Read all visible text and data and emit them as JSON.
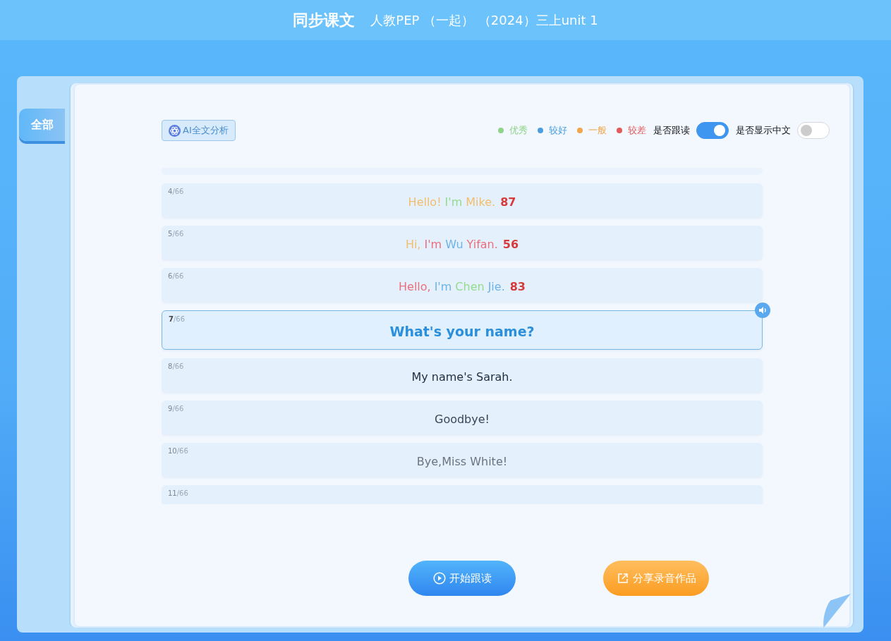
{
  "header": {
    "title": "同步课文",
    "subtitle": "人教PEP （一起） （2024）三上unit 1"
  },
  "sidebar": {
    "tabs": [
      {
        "label": "全部",
        "selected": true
      }
    ]
  },
  "toolbar": {
    "ai_button": "AI全文分析",
    "legend": [
      {
        "label": "优秀",
        "color": "#8fd48a"
      },
      {
        "label": "较好",
        "color": "#4a9ee0"
      },
      {
        "label": "一般",
        "color": "#f0a64a"
      },
      {
        "label": "较差",
        "color": "#e25a5a"
      }
    ],
    "toggles": [
      {
        "label": "是否跟读",
        "on": true
      },
      {
        "label": "是否显示中文",
        "on": false
      }
    ]
  },
  "sentences": [
    {
      "index": "4",
      "total": "/66",
      "selected": false,
      "score": "87",
      "words": [
        {
          "text": "Hello!",
          "color": "#f2bd6e"
        },
        {
          "text": "I'm",
          "color": "#93db8e"
        },
        {
          "text": "Mike.",
          "color": "#f2bd6e"
        }
      ]
    },
    {
      "index": "5",
      "total": "/66",
      "selected": false,
      "score": "56",
      "words": [
        {
          "text": "Hi,",
          "color": "#f2bd6e"
        },
        {
          "text": "I'm",
          "color": "#ea6f7c"
        },
        {
          "text": "Wu",
          "color": "#6fb3e6"
        },
        {
          "text": "Yifan.",
          "color": "#ea6f7c"
        }
      ]
    },
    {
      "index": "6",
      "total": "/66",
      "selected": false,
      "score": "83",
      "words": [
        {
          "text": "Hello,",
          "color": "#ea6f7c"
        },
        {
          "text": "I'm",
          "color": "#6fb3e6"
        },
        {
          "text": "Chen",
          "color": "#93db8e"
        },
        {
          "text": "Jie.",
          "color": "#6fb3e6"
        }
      ]
    },
    {
      "index": "7",
      "total": "/66",
      "selected": true,
      "text": "What's your name?"
    },
    {
      "index": "8",
      "total": "/66",
      "selected": false,
      "text": "My name's Sarah."
    },
    {
      "index": "9",
      "total": "/66",
      "selected": false,
      "text": "Goodbye!"
    },
    {
      "index": "10",
      "total": "/66",
      "selected": false,
      "text": "Bye,Miss White!"
    },
    {
      "index": "11",
      "total": "/66",
      "selected": false
    }
  ],
  "buttons": [
    {
      "label": "开始跟读",
      "kind": "start"
    },
    {
      "label": "分享录音作品",
      "kind": "share"
    }
  ]
}
